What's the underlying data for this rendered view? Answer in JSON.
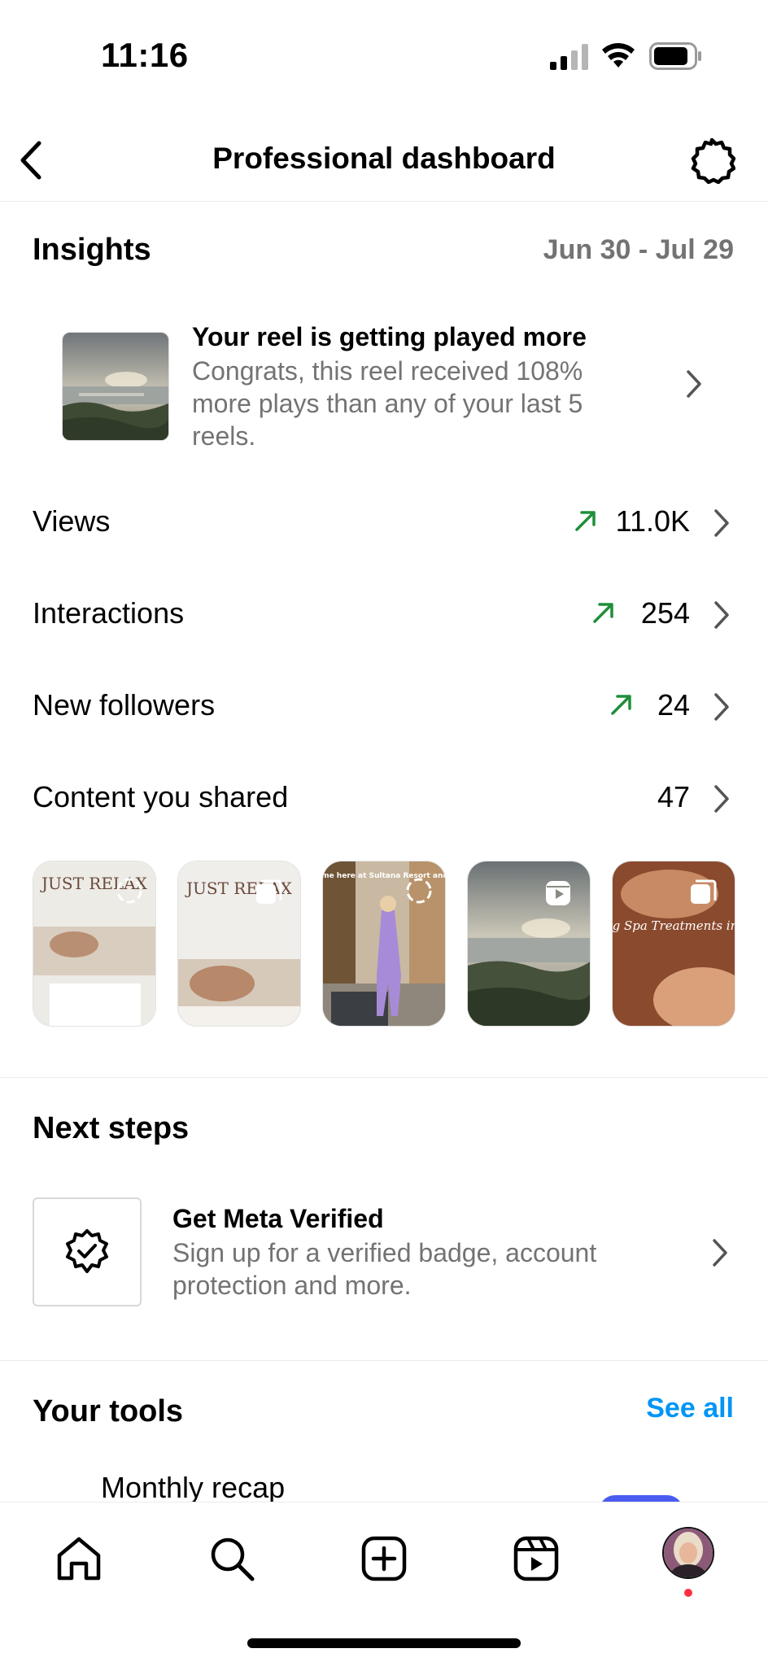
{
  "status_bar": {
    "time": "11:16"
  },
  "header": {
    "title": "Professional dashboard"
  },
  "insights": {
    "title": "Insights",
    "date_range": "Jun 30 - Jul 29",
    "reel_card": {
      "title": "Your reel is getting played more",
      "description": "Congrats, this reel received 108% more plays than any of your last 5 reels."
    },
    "metrics": [
      {
        "label": "Views",
        "value": "11.0K",
        "trend": "up"
      },
      {
        "label": "Interactions",
        "value": "254",
        "trend": "up"
      },
      {
        "label": "New followers",
        "value": "24",
        "trend": "up"
      },
      {
        "label": "Content you shared",
        "value": "47",
        "trend": "none"
      }
    ],
    "content_thumbnails": [
      {
        "kind": "story",
        "image_text": "JUST RELAX"
      },
      {
        "kind": "carousel",
        "image_text": "JUST RELAX"
      },
      {
        "kind": "story",
        "image_text": "Join me here at Sultana Resort and Spa"
      },
      {
        "kind": "reel",
        "image_text": ""
      },
      {
        "kind": "carousel",
        "image_text": "Trending Spa Treatments in the UK"
      }
    ]
  },
  "next_steps": {
    "title": "Next steps",
    "item": {
      "title": "Get Meta Verified",
      "description": "Sign up for a verified badge, account protection and more."
    }
  },
  "tools": {
    "title": "Your tools",
    "see_all": "See all",
    "first_item": "Monthly recap"
  },
  "bottom_nav": {
    "items": [
      "home-icon",
      "search-icon",
      "create-icon",
      "reels-icon",
      "profile-avatar"
    ]
  },
  "colors": {
    "trend_up": "#1f8f3a",
    "link": "#0095f6",
    "secondary_text": "#737373",
    "notification": "#ff3040"
  }
}
